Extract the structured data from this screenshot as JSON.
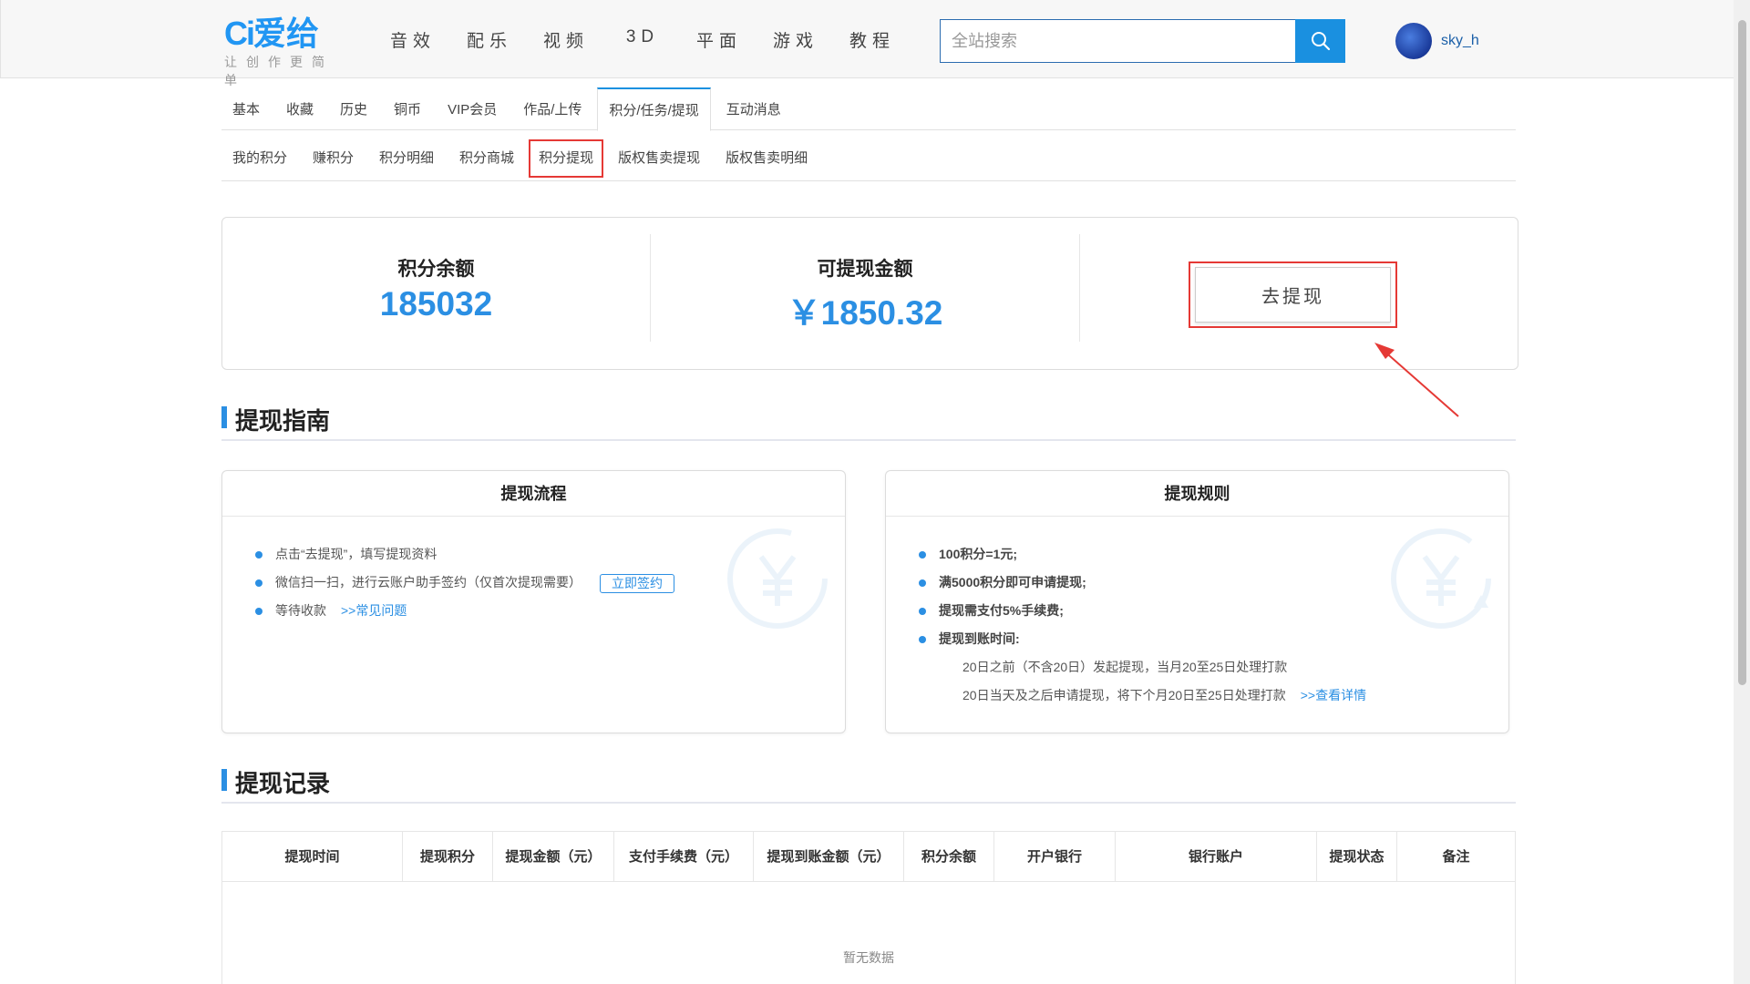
{
  "header": {
    "logo_mark": "Ci",
    "logo_brand": "爱给",
    "logo_slogan": "让创作更简单",
    "nav": [
      "音效",
      "配乐",
      "视频",
      "3D",
      "平面",
      "游戏",
      "教程"
    ],
    "search_placeholder": "全站搜索",
    "username": "sky_h"
  },
  "tabs_primary": [
    "基本",
    "收藏",
    "历史",
    "铜币",
    "VIP会员",
    "作品/上传",
    "积分/任务/提现",
    "互动消息"
  ],
  "tabs_secondary": [
    "我的积分",
    "赚积分",
    "积分明细",
    "积分商城",
    "积分提现",
    "版权售卖提现",
    "版权售卖明细"
  ],
  "balance": {
    "points_label": "积分余额",
    "points_value": "185032",
    "amount_label": "可提现金额",
    "amount_value": "￥1850.32",
    "withdraw_label": "去提现"
  },
  "guide": {
    "title": "提现指南",
    "process": {
      "title": "提现流程",
      "step1": "点击“去提现”，填写提现资料",
      "step2": "微信扫一扫，进行云账户助手签约（仅首次提现需要）",
      "sign_label": "立即签约",
      "step3": "等待收款",
      "faq_link": ">>常见问题"
    },
    "rules": {
      "title": "提现规则",
      "rule1": "100积分=1元;",
      "rule2": "满5000积分即可申请提现;",
      "rule3": "提现需支付5%手续费;",
      "rule4": "提现到账时间:",
      "rule4a": "20日之前（不含20日）发起提现，当月20至25日处理打款",
      "rule4b": "20日当天及之后申请提现，将下个月20日至25日处理打款",
      "detail_link": ">>查看详情"
    }
  },
  "records": {
    "title": "提现记录",
    "columns": [
      "提现时间",
      "提现积分",
      "提现金额（元）",
      "支付手续费（元）",
      "提现到账金额（元）",
      "积分余额",
      "开户银行",
      "银行账户",
      "提现状态",
      "备注"
    ],
    "empty_text": "暂无数据"
  },
  "colors": {
    "accent": "#2b8fe3",
    "highlight": "#e53935"
  }
}
